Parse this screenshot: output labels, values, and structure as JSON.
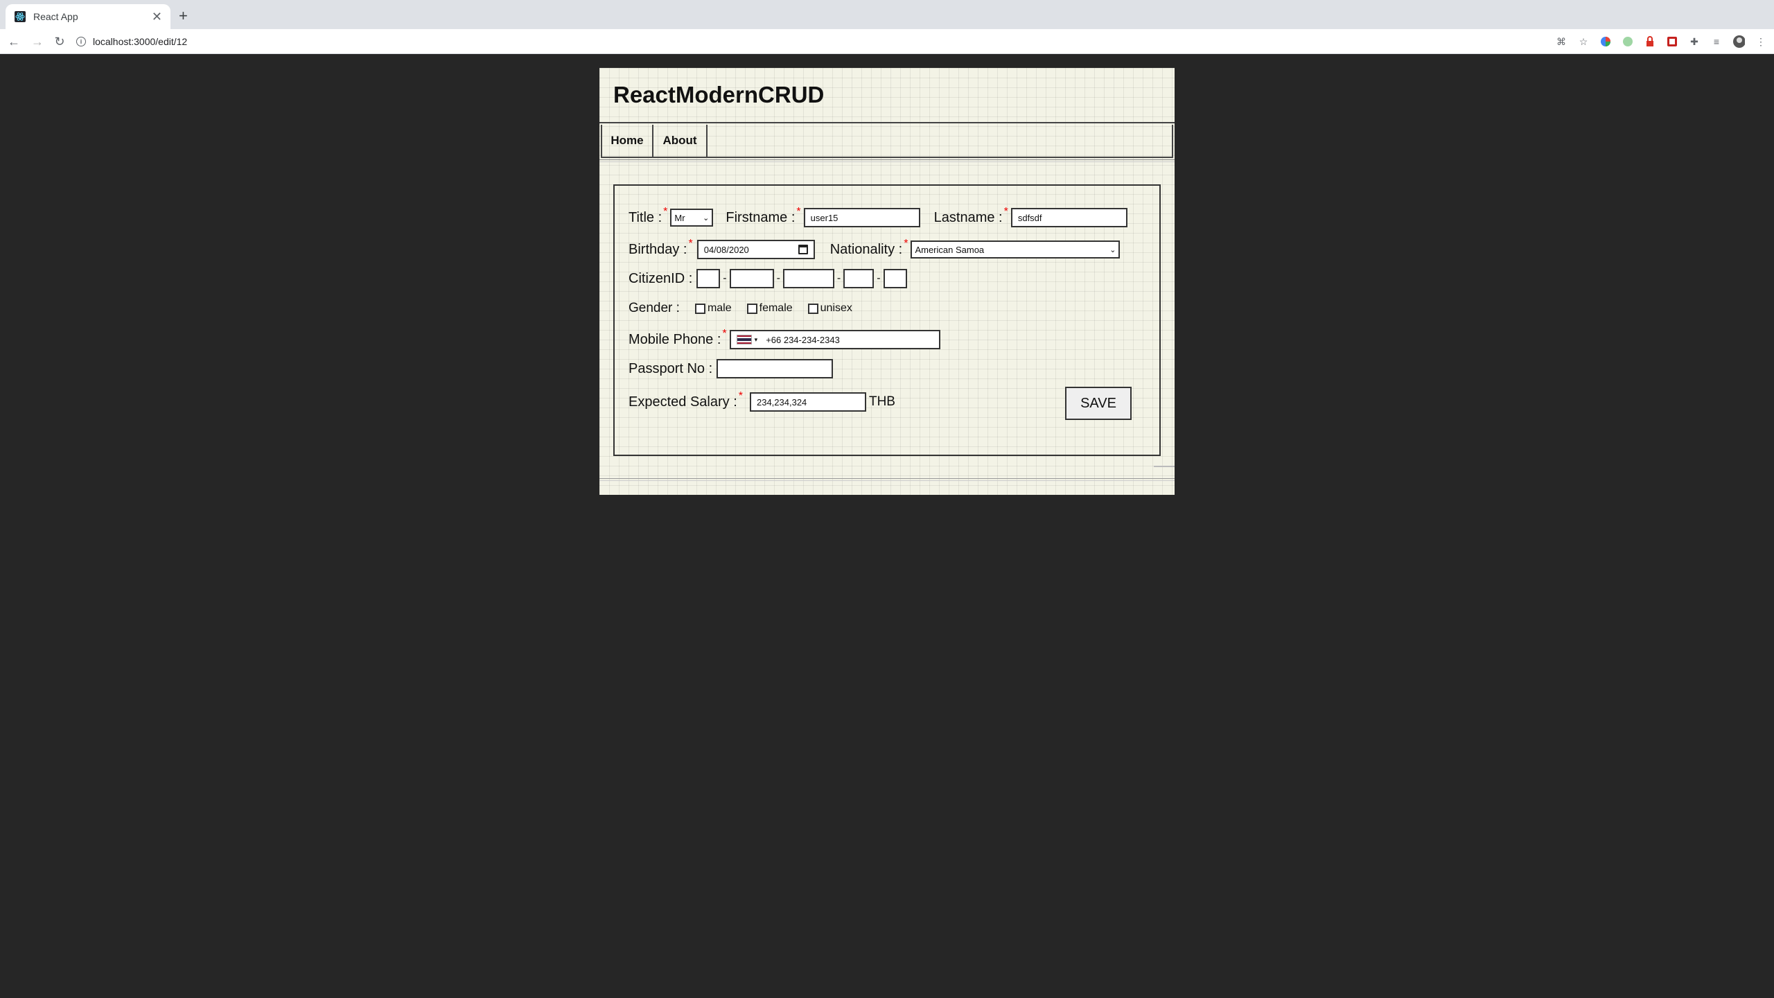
{
  "browser": {
    "tab_title": "React App",
    "tab_close": "✕",
    "new_tab": "+",
    "url": "localhost:3000/edit/12"
  },
  "app": {
    "title": "ReactModernCRUD",
    "menu": [
      {
        "label": "Home"
      },
      {
        "label": "About"
      }
    ]
  },
  "form": {
    "title_label": "Title :",
    "title_value": "Mr",
    "firstname_label": "Firstname :",
    "firstname_value": "user15",
    "lastname_label": "Lastname :",
    "lastname_value": "sdfsdf",
    "birthday_label": "Birthday :",
    "birthday_value": "04/08/2020",
    "nationality_label": "Nationality :",
    "nationality_value": "American Samoa",
    "citizenid_label": "CitizenID :",
    "gender_label": "Gender :",
    "gender_options": [
      "male",
      "female",
      "unisex"
    ],
    "mobile_label": "Mobile Phone :",
    "mobile_value": "+66 234-234-2343",
    "passport_label": "Passport No :",
    "passport_value": "",
    "salary_label": "Expected Salary :",
    "salary_value": "234,234,324",
    "salary_currency": "THB",
    "required_mark": "*",
    "save_label": "SAVE"
  },
  "colors": {
    "page_bg": "#262626",
    "app_bg": "#f3f3e6",
    "required": "#ee0000"
  }
}
